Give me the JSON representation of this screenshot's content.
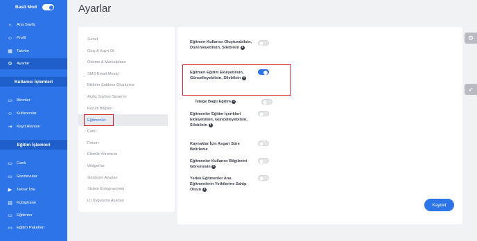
{
  "sidebar": {
    "mode_label": "Basit Mod",
    "items": [
      {
        "label": "Ana Sayfa",
        "icon": "home-icon",
        "glyph": "⌂",
        "active": false
      },
      {
        "label": "Profil",
        "icon": "user-icon",
        "glyph": "☺",
        "active": false
      },
      {
        "label": "Takvim",
        "icon": "calendar-icon",
        "glyph": "▦",
        "active": false
      },
      {
        "label": "Ayarlar",
        "icon": "gear-icon",
        "glyph": "⚙",
        "active": true
      }
    ],
    "section_users": "Kullanıcı İşlemleri",
    "user_items": [
      {
        "label": "Birimler",
        "icon": "folder-icon",
        "glyph": "▭"
      },
      {
        "label": "Kullanıcılar",
        "icon": "users-icon",
        "glyph": "☺"
      },
      {
        "label": "Kayıt Alanları",
        "icon": "signin-icon",
        "glyph": "⇥"
      }
    ],
    "section_education": "Eğitim İşlemleri",
    "education_items": [
      {
        "label": "Canlı",
        "icon": "live-icon",
        "glyph": "▭"
      },
      {
        "label": "Randevular",
        "icon": "appointment-icon",
        "glyph": "▭"
      },
      {
        "label": "Tekrar İzle",
        "icon": "replay-icon",
        "glyph": "▶"
      },
      {
        "label": "Kütüphane",
        "icon": "library-icon",
        "glyph": "▤"
      },
      {
        "label": "Eğitimler",
        "icon": "courses-icon",
        "glyph": "▭"
      },
      {
        "label": "Eğitim Paketleri",
        "icon": "package-icon",
        "glyph": "▭"
      }
    ]
  },
  "page": {
    "title": "Ayarlar"
  },
  "settings_menu": [
    {
      "label": "Genel",
      "selected": false
    },
    {
      "label": "Giriş & Kayıt Ol",
      "selected": false
    },
    {
      "label": "Ödeme & Marketplace",
      "selected": false
    },
    {
      "label": "SMS-Email-Mesaj",
      "selected": false
    },
    {
      "label": "Bildirim Şablonu Oluşturma",
      "selected": false
    },
    {
      "label": "Açılış Sayfası Tasarımı",
      "selected": false
    },
    {
      "label": "Kurum Bilgileri",
      "selected": false
    },
    {
      "label": "Eğitmenler",
      "selected": true
    },
    {
      "label": "Canlı",
      "selected": false
    },
    {
      "label": "Forum",
      "selected": false
    },
    {
      "label": "Etkinlik Yöneticisi",
      "selected": false
    },
    {
      "label": "Widget'lar",
      "selected": false
    },
    {
      "label": "Görünüm Ayarları",
      "selected": false
    },
    {
      "label": "Sistem Entegrasyonu",
      "selected": false
    },
    {
      "label": "Lti Uygulama Ayarları",
      "selected": false
    }
  ],
  "settings": [
    {
      "label": "Eğitmen Kullanıcı Oluşturabilsin, Düzenleyebilsin, Silebilsin",
      "on": false,
      "info": true
    },
    {
      "label": "Eğitmen Eğitim Ekleyebilsin, Güncelleyebilsin, Silebilsin",
      "on": true,
      "info": true
    },
    {
      "label": "İsteğe Bağlı Eğitim",
      "on": false,
      "info": true
    },
    {
      "label": "Eğitmenler Eğitim İçerikleri Ekleyebilsin, Güncelleyebilsin, Silebilsin",
      "on": false,
      "info": true
    },
    {
      "label": "Kaynaklar İçin Asgari Süre Belirleme",
      "on": false,
      "info": false
    },
    {
      "label": "Eğitmenler Kullanıcı Bilgilerini Göremesin",
      "on": false,
      "info": true
    },
    {
      "label": "Yedek Eğitmenler Ana Eğitmenlerin Yetkilerine Sahip Olsun",
      "on": false,
      "info": true
    }
  ],
  "save_label": "Kaydet",
  "colors": {
    "primary": "#2d74e8",
    "highlight": "#d6232a"
  }
}
